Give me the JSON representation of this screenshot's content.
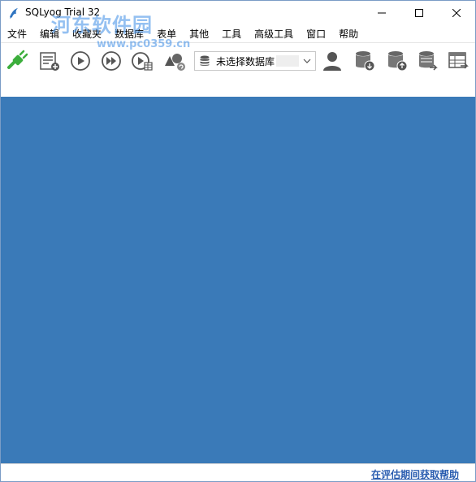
{
  "window": {
    "title": "SQLyog Trial 32"
  },
  "watermark": {
    "text": "河东软件园",
    "url": "www.pc0359.cn"
  },
  "menu": {
    "items": [
      "文件",
      "编辑",
      "收藏夹",
      "数据库",
      "表单",
      "其他",
      "工具",
      "高级工具",
      "窗口",
      "帮助"
    ]
  },
  "toolbar": {
    "database_select": {
      "value": "未选择数据库"
    },
    "icons": [
      "connect-icon",
      "new-query-icon",
      "execute-icon",
      "execute-all-icon",
      "execute-edit-icon",
      "schema-designer-icon",
      "user-manager-icon",
      "backup-database-icon",
      "restore-database-icon",
      "database-sync-icon",
      "table-data-icon"
    ]
  },
  "colors": {
    "workspace": "#3a7ab8",
    "link": "#2a5db0",
    "accent_green": "#3cae3c"
  },
  "statusbar": {
    "help_link": "在评估期间获取帮助"
  }
}
